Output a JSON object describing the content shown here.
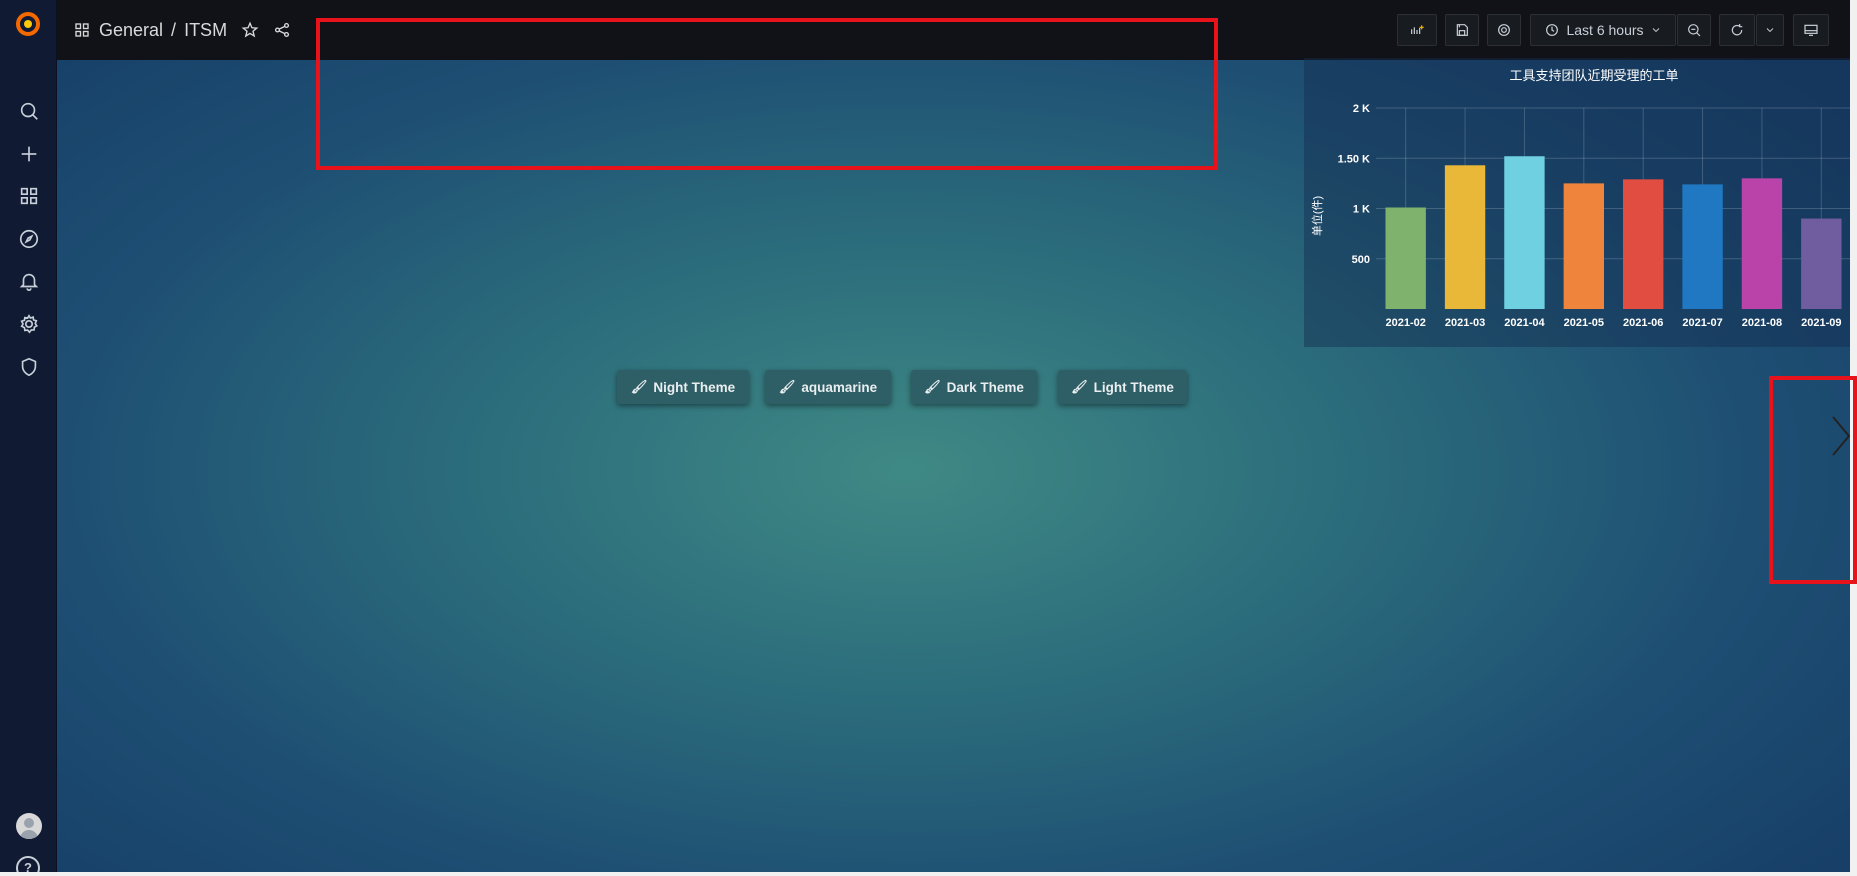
{
  "breadcrumb": {
    "folder": "General",
    "separator": "/",
    "dashboard": "ITSM"
  },
  "icons": {
    "logo": "grafana-logo-icon",
    "sidebar": [
      "search-icon",
      "plus-icon",
      "dashboards-icon",
      "explore-compass-icon",
      "alert-bell-icon",
      "settings-gear-icon",
      "shield-icon"
    ],
    "toolbar": [
      "add-panel-icon",
      "save-icon",
      "dashboard-settings-icon",
      "clock-icon",
      "zoom-out-icon",
      "refresh-icon",
      "chevron-down-icon",
      "tv-mode-icon"
    ]
  },
  "toolbar": {
    "time_range": "Last 6 hours"
  },
  "themes": {
    "buttons": [
      "Night Theme",
      "aquamarine",
      "Dark Theme",
      "Light Theme"
    ]
  },
  "colors": {
    "annotation_red": "#e8121a",
    "sidebar_bg": "#111a33",
    "topbar_bg": "#111217"
  },
  "chart_data": {
    "type": "bar",
    "title": "工具支持团队近期受理的工单",
    "ylabel": "单位(件)",
    "xlabel": "",
    "categories": [
      "2021-02",
      "2021-03",
      "2021-04",
      "2021-05",
      "2021-06",
      "2021-07",
      "2021-08",
      "2021-09"
    ],
    "values": [
      1010,
      1430,
      1520,
      1250,
      1290,
      1240,
      1300,
      900
    ],
    "colors": [
      "#7eb26d",
      "#eab839",
      "#6ed0e0",
      "#ef843c",
      "#e24d42",
      "#1f78c1",
      "#ba43a9",
      "#705da0"
    ],
    "ylim": [
      0,
      2000
    ],
    "yticks": [
      500,
      1000,
      1500,
      2000
    ],
    "ytick_labels": [
      "500",
      "1 K",
      "1.50 K",
      "2 K"
    ],
    "grid": true
  }
}
